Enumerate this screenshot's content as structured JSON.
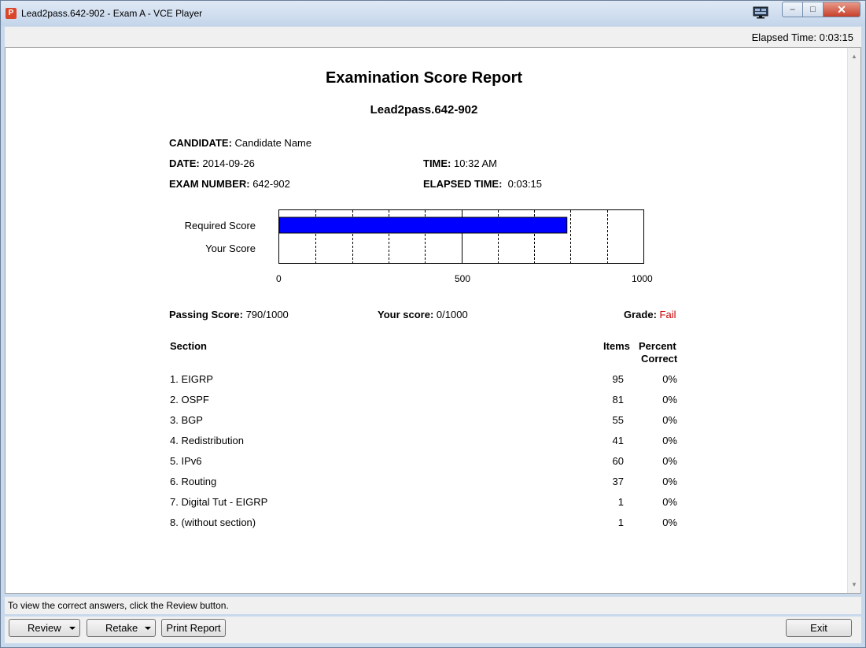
{
  "window": {
    "title": "Lead2pass.642-902 - Exam A - VCE Player",
    "app_icon_letter": "P",
    "controls": {
      "minimize": "–",
      "maximize": "□",
      "close": "✕"
    }
  },
  "topbar": {
    "elapsed": "Elapsed Time: 0:03:15"
  },
  "report": {
    "title": "Examination Score Report",
    "subtitle": "Lead2pass.642-902",
    "candidate_label": "CANDIDATE:",
    "candidate_value": "Candidate Name",
    "date_label": "DATE:",
    "date_value": "2014-09-26",
    "time_label": "TIME:",
    "time_value": "10:32 AM",
    "exam_label": "EXAM NUMBER:",
    "exam_value": "642-902",
    "elapsed_label": "ELAPSED TIME:",
    "elapsed_value": "0:03:15",
    "passing_label": "Passing Score:",
    "passing_value": "790/1000",
    "your_label": "Your score:",
    "your_value": "0/1000",
    "grade_label": "Grade:",
    "grade_value": "Fail",
    "grade_color": "#cc0000"
  },
  "chart_data": {
    "type": "bar",
    "orientation": "horizontal",
    "categories": [
      "Required Score",
      "Your Score"
    ],
    "values": [
      790,
      0
    ],
    "xlim": [
      0,
      1000
    ],
    "ticks": [
      "0",
      "500",
      "1000"
    ],
    "bar_color": "#0000ff",
    "grid": true
  },
  "table": {
    "headers": {
      "section": "Section",
      "items": "Items",
      "percent_1": "Percent",
      "percent_2": "Correct"
    },
    "rows": [
      {
        "section": "1. EIGRP",
        "items": "95",
        "percent": "0%"
      },
      {
        "section": "2. OSPF",
        "items": "81",
        "percent": "0%"
      },
      {
        "section": "3. BGP",
        "items": "55",
        "percent": "0%"
      },
      {
        "section": "4. Redistribution",
        "items": "41",
        "percent": "0%"
      },
      {
        "section": "5. IPv6",
        "items": "60",
        "percent": "0%"
      },
      {
        "section": "6. Routing",
        "items": "37",
        "percent": "0%"
      },
      {
        "section": "7. Digital Tut - EIGRP",
        "items": "1",
        "percent": "0%"
      },
      {
        "section": "8. (without section)",
        "items": "1",
        "percent": "0%"
      }
    ]
  },
  "status": {
    "text": "To view the correct answers, click the Review button."
  },
  "buttons": {
    "review": "Review",
    "retake": "Retake",
    "print": "Print Report",
    "exit": "Exit"
  }
}
